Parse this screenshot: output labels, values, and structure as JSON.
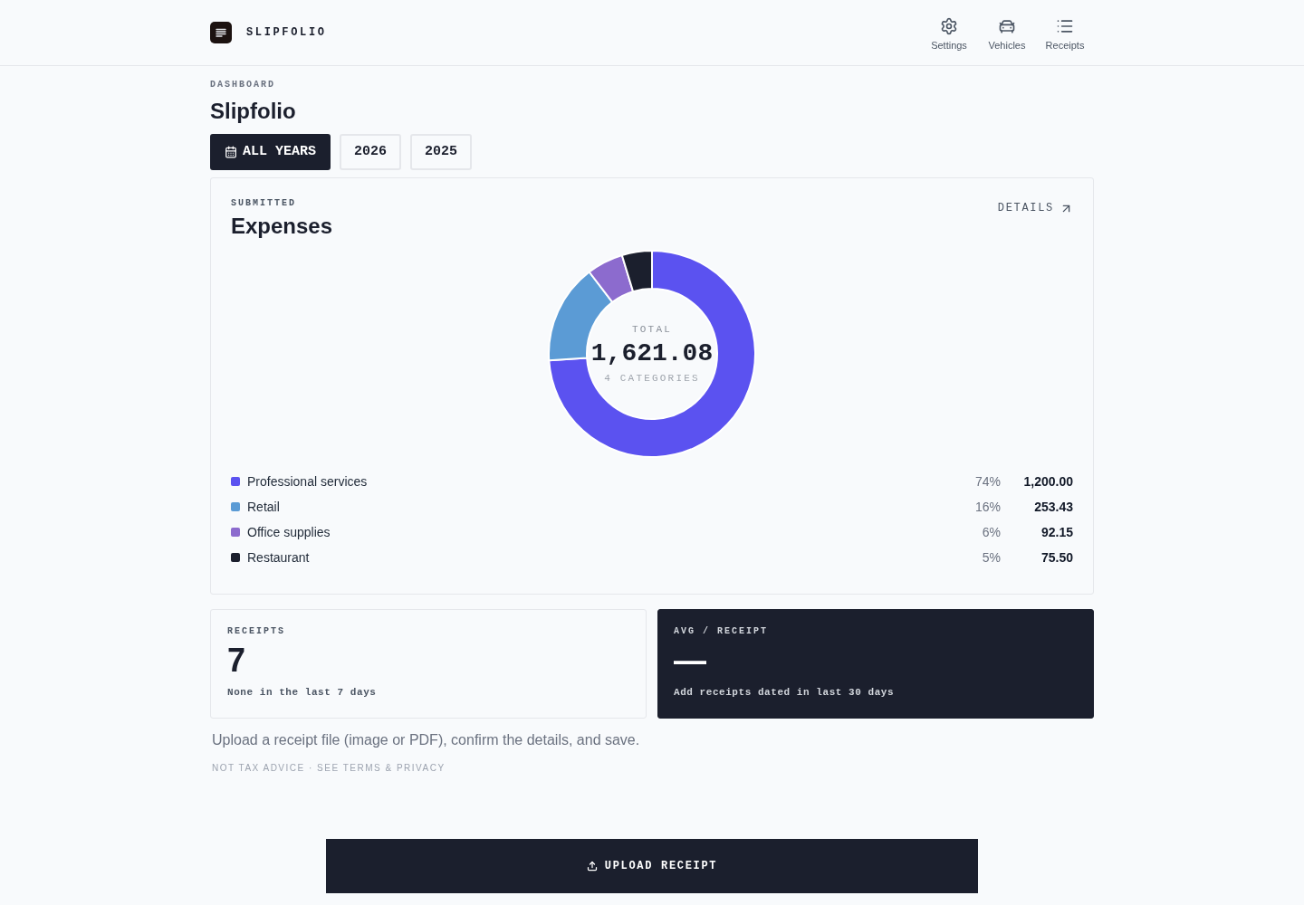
{
  "header": {
    "brand": "SLIPFOLIO",
    "nav": [
      {
        "label": "Settings"
      },
      {
        "label": "Vehicles"
      },
      {
        "label": "Receipts"
      }
    ]
  },
  "page": {
    "eyebrow": "DASHBOARD",
    "title": "Slipfolio"
  },
  "year_tabs": [
    {
      "label": "ALL YEARS",
      "kind": "all",
      "selected": true
    },
    {
      "label": "2026",
      "kind": "year",
      "selected": false
    },
    {
      "label": "2025",
      "kind": "year",
      "selected": false
    }
  ],
  "expenses_card": {
    "eyebrow": "SUBMITTED",
    "title": "Expenses",
    "details_link": "DETAILS",
    "total_label": "TOTAL",
    "total": "1,621.08",
    "category_count": "4 CATEGORIES",
    "chart_data": {
      "type": "donut",
      "categories": [
        "Professional services",
        "Retail",
        "Office supplies",
        "Restaurant"
      ],
      "values": [
        74.0,
        15.6,
        5.7,
        4.7
      ]
    },
    "legend": [
      {
        "color": "#5b52f0",
        "percent": "74%",
        "amount": "1,200.00"
      },
      {
        "color": "#5b9bd5",
        "percent": "16%",
        "amount": "253.43"
      },
      {
        "color": "#8c6bce",
        "percent": "6%",
        "amount": "92.15"
      },
      {
        "color": "#1b1f2d",
        "percent": "5%",
        "amount": "75.50"
      }
    ]
  },
  "stats": [
    {
      "kind": "outline",
      "label": "RECEIPTS",
      "value": "7",
      "note": "None in the last 7 days"
    },
    {
      "kind": "filled",
      "label": "AVG / RECEIPT",
      "value": "—",
      "note": "Add receipts dated in last 30 days"
    }
  ],
  "help_text": "Upload a receipt file (image or PDF), confirm the details, and save.",
  "footer_note": "NOT TAX ADVICE · SEE TERMS & PRIVACY",
  "upload_button": "UPLOAD RECEIPT"
}
